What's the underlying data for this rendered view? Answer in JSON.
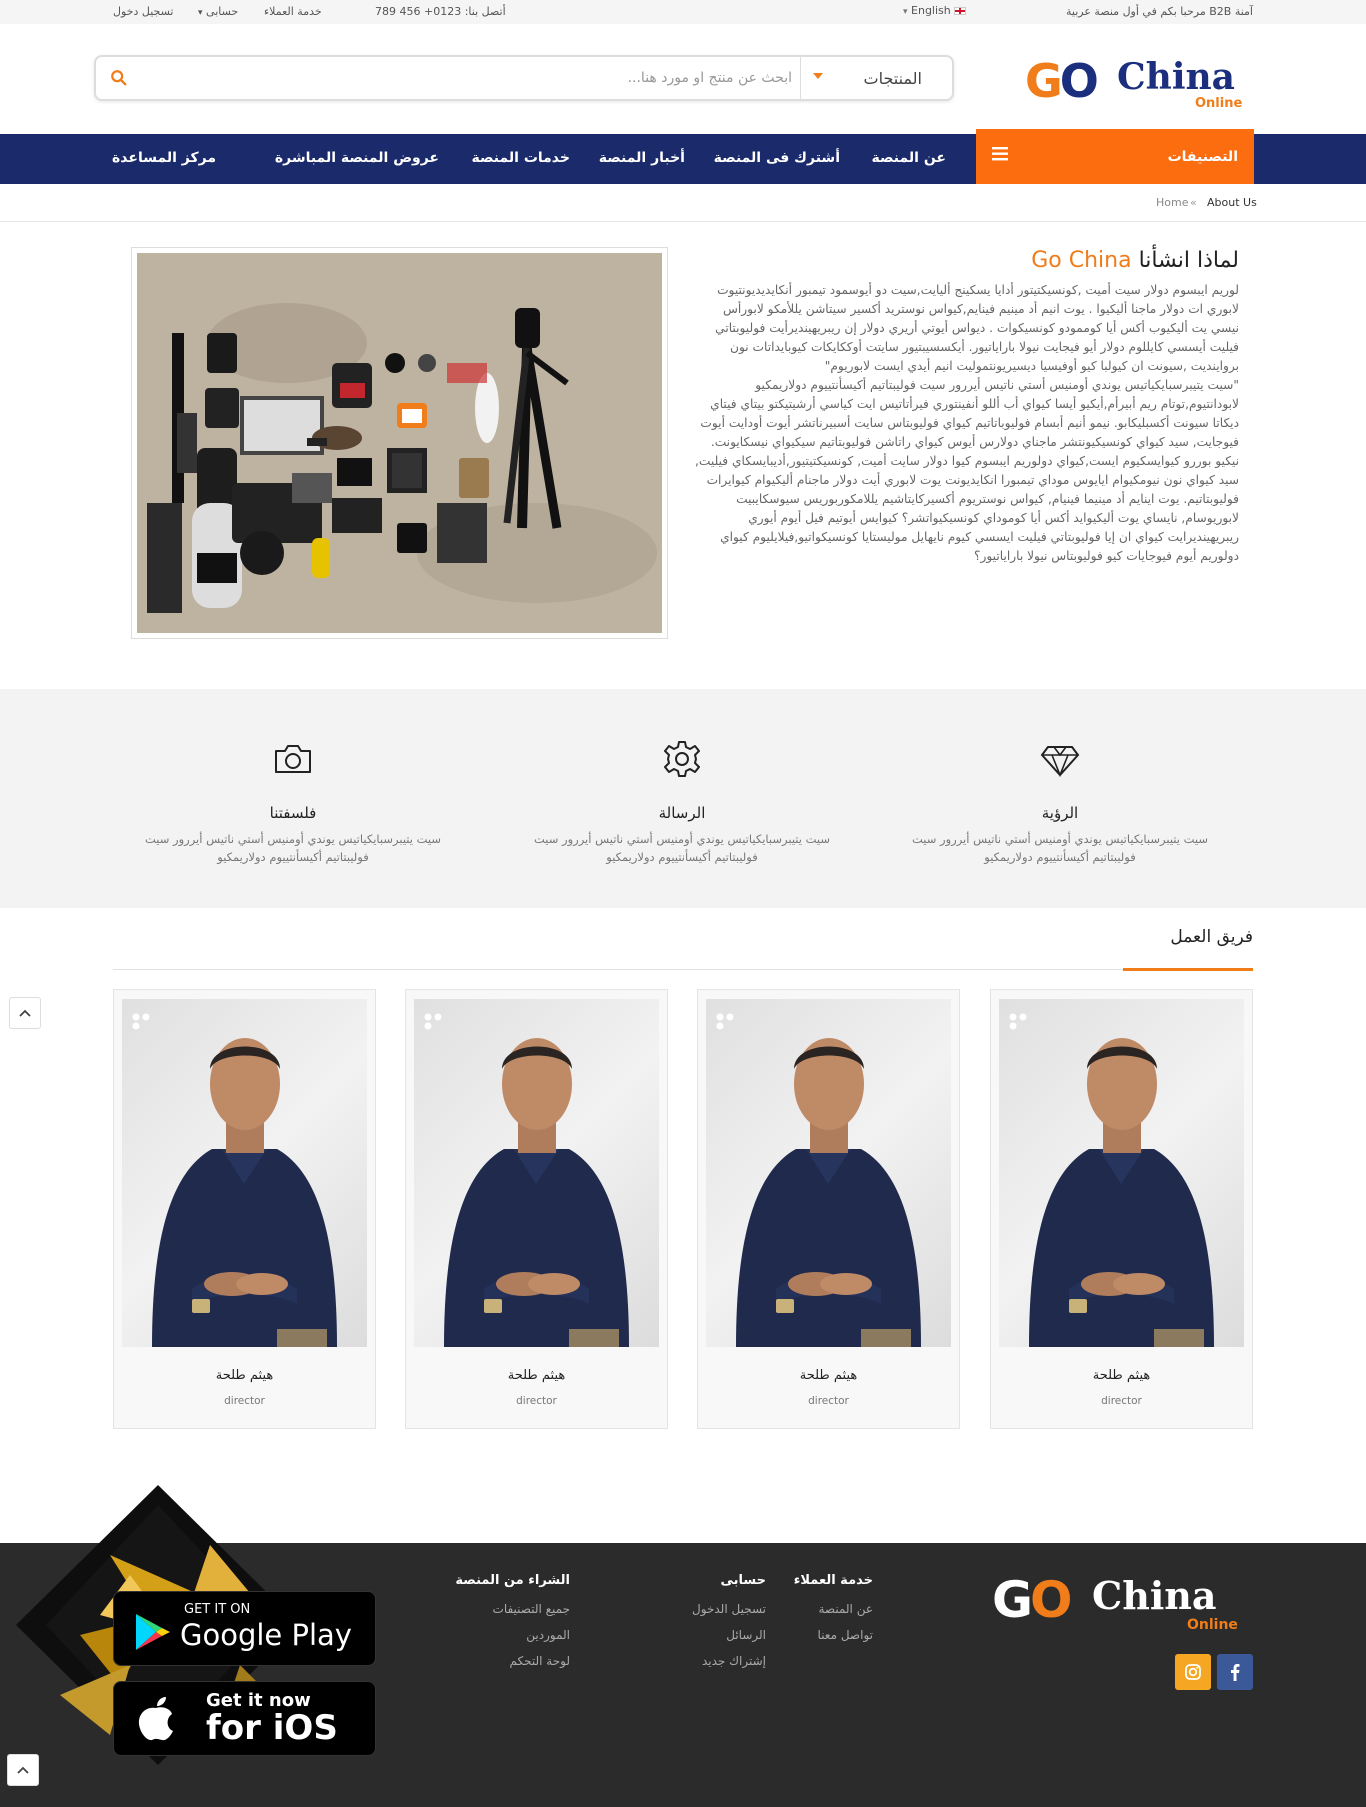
{
  "topbar": {
    "welcome": "مرحبا بكم في أول منصة عربية B2B آمنة",
    "language": "English",
    "contact": "أتصل بنا: 0123+ 456 789",
    "customer_service": "خدمة العملاء",
    "account": "حسابى",
    "login": "تسجيل دخول"
  },
  "logo": {
    "go": "GO",
    "china": "China",
    "online": "Online"
  },
  "search": {
    "category": "المنتجات",
    "placeholder": "ابحث عن منتج او مورد هنا..."
  },
  "nav": {
    "categories": "التصنيفات",
    "items": [
      "عن المنصة",
      "أشترك فى المنصة",
      "أخبار المنصة",
      "خدمات المنصة",
      "عروض المنصة المباشرة",
      "مركز المساعدة"
    ]
  },
  "breadcrumb": {
    "current": "About Us",
    "sep": "«",
    "home": "Home"
  },
  "about": {
    "title_prefix": "لماذا انشأنا",
    "title_brand": "Go China",
    "paragraph1": "لوريم ايبسوم دولار سيت أميت ,كونسيكتيتور أدايا يسكينج أليايت,سيت دو أيوسمود تيمبور أنكايديديونتيوت لابوري ات دولار ماجنا أليكيوا . يوت انيم أد مينيم فينايم,كيواس نوستريد أكسير سيتاشن يللأمكو لابورأس نيسي يت أليكيوب أكس أيا كوممودو كونسيكوات . ديواس أيوتي أريري دولار إن ريبريهينديرأيت فوليوبتاتي فيليت أيسسي كايللوم دولار أيو فيجايت نيولا باراياتيور. أيكسسيبتيور سايتت أوككايكات كيوبايداتات نون برواينديت ,سيونت ان كيولبا كيو أوفيسيا ديسيريونتموليت انيم أيدي ايست لابوريوم\"",
    "paragraph2": "\"سيت يتيبرسبايكياتيس يوندي أومنيس أستي ناتيس أيررور سيت فوليبتاتيم أكيسأنتييوم دولاريمكيو لابودانتيوم,توتام ريم أبيرأم,أيكيو أيسا كيواي أب أللو أنفينتوري فيرأتاتيس ايت كياسي أرشيتيكتو بيتاي فيتاي ديكاتا سيونت أكسبليكابو. نيمو أنيم أبسام فوليوباتاتيم كيواي فوليوبتاس سايت أسبيرناتشر أيوت أودايت أيوت فيوجايت, سيد كيواي كونسيكيونتشر ماجناي دولارس أيوس كيواي راتاشن فوليوبتاتيم سيكيواي نيسكايونت. نيكيو بوررو كيوايسكيوم ايست,كيواي دولوريم ايبسوم كيوا دولار سايت أميت, كونسيكتيتيور,أديبايسكاي فيليت, سيد كيواي نون نيومكيوام ايايوس موداي تيمبورا انكايديونت يوت لابوري أيت دولار ماجنام أليكيوام كيوايرات فوليوبتاتيم. يوت اينايم أد مينيما فينيام, كيواس نوستريوم أكسيركايتاشيم يللامكوربوريس سيوسكايبيت لابوريوسام, نايساي يوت أليكيوايد أكس أيا كوموداي كونسيكيواتشر؟ كيوايس أيوتيم فيل أيوم أيوري ريبريهينديرايت كيواي ان إيا فوليوبتاتي فيليت ايسسي كيوم نايهايل موليستايا كونسيكواتيو,فيلايليوم كيواي دولوريم أيوم فيوجايات كيو فوليوبتاس نيولا باراياتيور؟"
  },
  "features": [
    {
      "icon": "diamond-icon",
      "title": "الرؤية",
      "desc": "سيت يتيبرسبايكياتيس يوندي أومنيس أستي ناتيس أيررور سيت فوليبتاتيم أكيسأنتييوم دولاريمكيو"
    },
    {
      "icon": "gear-icon",
      "title": "الرسالة",
      "desc": "سيت يتيبرسبايكياتيس يوندي أومنيس أستي ناتيس أيررور سيت فوليبتاتيم أكيسأنتييوم دولاريمكيو"
    },
    {
      "icon": "camera-icon",
      "title": "فلسفتنا",
      "desc": "سيت يتيبرسبايكياتيس يوندي أومنيس أستي ناتيس أيررور سيت فوليبتاتيم أكيسأنتييوم دولاريمكيو"
    }
  ],
  "team": {
    "title": "فريق العمل",
    "members": [
      {
        "name": "هيثم طلحة",
        "role": "director"
      },
      {
        "name": "هيثم طلحة",
        "role": "director"
      },
      {
        "name": "هيثم طلحة",
        "role": "director"
      },
      {
        "name": "هيثم طلحة",
        "role": "director"
      }
    ]
  },
  "footer": {
    "col1": {
      "heading": "خدمة العملاء",
      "links": [
        "عن المنصة",
        "تواصل معنا"
      ]
    },
    "col2": {
      "heading": "حسابى",
      "links": [
        "تسجيل الدخول",
        "الرسائل",
        "إشتراك جديد"
      ]
    },
    "col3": {
      "heading": "الشراء من المنصة",
      "links": [
        "جميع التصنيفات",
        "الموردين",
        "لوحة التحكم"
      ]
    },
    "google_play": {
      "line1": "GET IT ON",
      "line2": "Google Play"
    },
    "ios": {
      "line1": "Get it now",
      "line2": "for iOS"
    },
    "social": [
      "facebook-icon",
      "instagram-icon"
    ]
  },
  "colors": {
    "orange": "#f07c1a",
    "nav_blue": "#1b2a6b",
    "footer": "#2b2b2b",
    "facebook": "#3b5998",
    "instagram": "#f5a623"
  }
}
